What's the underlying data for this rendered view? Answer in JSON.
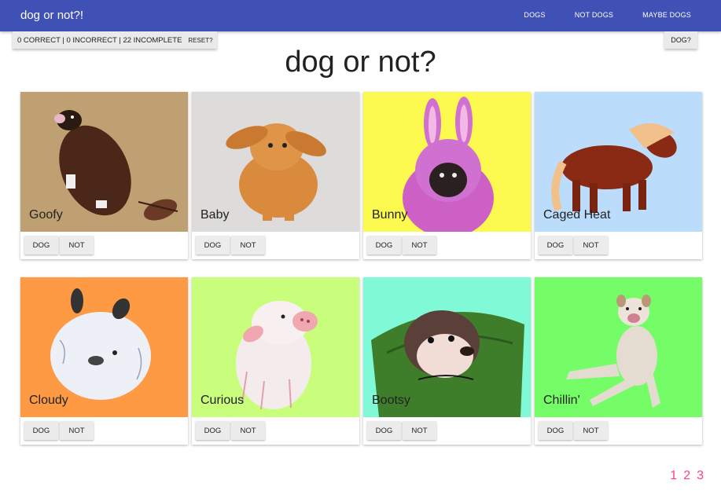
{
  "app": {
    "title": "dog or not?!",
    "nav": [
      "DOGS",
      "NOT DOGS",
      "MAYBE DOGS"
    ]
  },
  "score": {
    "text": "0 CORRECT | 0 INCORRECT | 22 INCOMPLETE",
    "reset_label": "RESET?"
  },
  "dog_question": "DOG?",
  "page_title": "dog or not?",
  "cards": [
    {
      "name": "Goofy",
      "bg": "#bfa072",
      "animal": "beaver-dog",
      "dog_label": "DOG",
      "not_label": "NOT"
    },
    {
      "name": "Baby",
      "bg": "#dddcdb",
      "animal": "bunny",
      "dog_label": "DOG",
      "not_label": "NOT"
    },
    {
      "name": "Bunny",
      "bg": "#fdfa4f",
      "animal": "pug-in-bunny-suit",
      "dog_label": "DOG",
      "not_label": "NOT"
    },
    {
      "name": "Caged Heat",
      "bg": "#bcdcfb",
      "animal": "pony",
      "dog_label": "DOG",
      "not_label": "NOT"
    },
    {
      "name": "Cloudy",
      "bg": "#fd9a43",
      "animal": "fluffy-bunny",
      "dog_label": "DOG",
      "not_label": "NOT"
    },
    {
      "name": "Curious",
      "bg": "#c9fd7c",
      "animal": "piglet",
      "dog_label": "DOG",
      "not_label": "NOT"
    },
    {
      "name": "Bootsy",
      "bg": "#80f9d6",
      "animal": "otter-in-bag",
      "dog_label": "DOG",
      "not_label": "NOT"
    },
    {
      "name": "Chillin'",
      "bg": "#74fd66",
      "animal": "bulldog",
      "dog_label": "DOG",
      "not_label": "NOT"
    }
  ],
  "pagination": [
    "1",
    "2",
    "3"
  ]
}
